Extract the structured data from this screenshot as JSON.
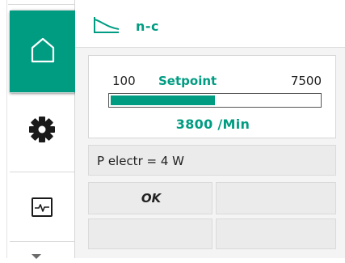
{
  "header": {
    "mode_icon": "control-curve-icon",
    "mode_label": "n-c"
  },
  "nav": {
    "items": [
      {
        "name": "home",
        "icon": "home-icon",
        "active": true
      },
      {
        "name": "settings",
        "icon": "gear-icon",
        "active": false
      },
      {
        "name": "diagnostics",
        "icon": "pulse-monitor-icon",
        "active": false
      }
    ],
    "more_icon": "chevron-down-icon"
  },
  "setpoint": {
    "min_label": "100",
    "title": "Setpoint",
    "max_label": "7500",
    "min": 100,
    "max": 7500,
    "value": 3800,
    "value_label": "3800 /Min"
  },
  "power": {
    "text": "P electr = 4 W"
  },
  "buttons": {
    "ok_label": "OK"
  },
  "colors": {
    "accent": "#009c82",
    "panel_grey": "#ebebeb",
    "text": "#222222"
  }
}
